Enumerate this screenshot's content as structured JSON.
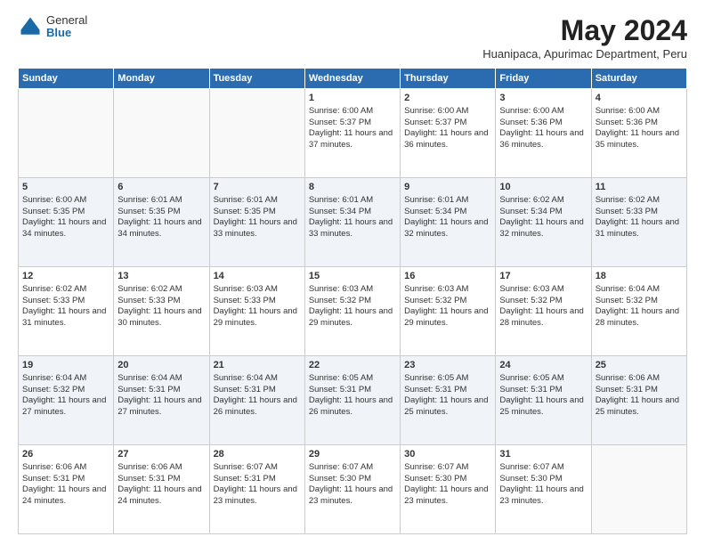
{
  "logo": {
    "general": "General",
    "blue": "Blue"
  },
  "title": "May 2024",
  "location": "Huanipaca, Apurimac Department, Peru",
  "days_of_week": [
    "Sunday",
    "Monday",
    "Tuesday",
    "Wednesday",
    "Thursday",
    "Friday",
    "Saturday"
  ],
  "weeks": [
    {
      "days": [
        {
          "num": "",
          "empty": true
        },
        {
          "num": "",
          "empty": true
        },
        {
          "num": "",
          "empty": true
        },
        {
          "num": "1",
          "sunrise": "6:00 AM",
          "sunset": "5:37 PM",
          "daylight": "11 hours and 37 minutes."
        },
        {
          "num": "2",
          "sunrise": "6:00 AM",
          "sunset": "5:37 PM",
          "daylight": "11 hours and 36 minutes."
        },
        {
          "num": "3",
          "sunrise": "6:00 AM",
          "sunset": "5:36 PM",
          "daylight": "11 hours and 36 minutes."
        },
        {
          "num": "4",
          "sunrise": "6:00 AM",
          "sunset": "5:36 PM",
          "daylight": "11 hours and 35 minutes."
        }
      ]
    },
    {
      "alt": true,
      "days": [
        {
          "num": "5",
          "sunrise": "6:00 AM",
          "sunset": "5:35 PM",
          "daylight": "11 hours and 34 minutes."
        },
        {
          "num": "6",
          "sunrise": "6:01 AM",
          "sunset": "5:35 PM",
          "daylight": "11 hours and 34 minutes."
        },
        {
          "num": "7",
          "sunrise": "6:01 AM",
          "sunset": "5:35 PM",
          "daylight": "11 hours and 33 minutes."
        },
        {
          "num": "8",
          "sunrise": "6:01 AM",
          "sunset": "5:34 PM",
          "daylight": "11 hours and 33 minutes."
        },
        {
          "num": "9",
          "sunrise": "6:01 AM",
          "sunset": "5:34 PM",
          "daylight": "11 hours and 32 minutes."
        },
        {
          "num": "10",
          "sunrise": "6:02 AM",
          "sunset": "5:34 PM",
          "daylight": "11 hours and 32 minutes."
        },
        {
          "num": "11",
          "sunrise": "6:02 AM",
          "sunset": "5:33 PM",
          "daylight": "11 hours and 31 minutes."
        }
      ]
    },
    {
      "days": [
        {
          "num": "12",
          "sunrise": "6:02 AM",
          "sunset": "5:33 PM",
          "daylight": "11 hours and 31 minutes."
        },
        {
          "num": "13",
          "sunrise": "6:02 AM",
          "sunset": "5:33 PM",
          "daylight": "11 hours and 30 minutes."
        },
        {
          "num": "14",
          "sunrise": "6:03 AM",
          "sunset": "5:33 PM",
          "daylight": "11 hours and 29 minutes."
        },
        {
          "num": "15",
          "sunrise": "6:03 AM",
          "sunset": "5:32 PM",
          "daylight": "11 hours and 29 minutes."
        },
        {
          "num": "16",
          "sunrise": "6:03 AM",
          "sunset": "5:32 PM",
          "daylight": "11 hours and 29 minutes."
        },
        {
          "num": "17",
          "sunrise": "6:03 AM",
          "sunset": "5:32 PM",
          "daylight": "11 hours and 28 minutes."
        },
        {
          "num": "18",
          "sunrise": "6:04 AM",
          "sunset": "5:32 PM",
          "daylight": "11 hours and 28 minutes."
        }
      ]
    },
    {
      "alt": true,
      "days": [
        {
          "num": "19",
          "sunrise": "6:04 AM",
          "sunset": "5:32 PM",
          "daylight": "11 hours and 27 minutes."
        },
        {
          "num": "20",
          "sunrise": "6:04 AM",
          "sunset": "5:31 PM",
          "daylight": "11 hours and 27 minutes."
        },
        {
          "num": "21",
          "sunrise": "6:04 AM",
          "sunset": "5:31 PM",
          "daylight": "11 hours and 26 minutes."
        },
        {
          "num": "22",
          "sunrise": "6:05 AM",
          "sunset": "5:31 PM",
          "daylight": "11 hours and 26 minutes."
        },
        {
          "num": "23",
          "sunrise": "6:05 AM",
          "sunset": "5:31 PM",
          "daylight": "11 hours and 25 minutes."
        },
        {
          "num": "24",
          "sunrise": "6:05 AM",
          "sunset": "5:31 PM",
          "daylight": "11 hours and 25 minutes."
        },
        {
          "num": "25",
          "sunrise": "6:06 AM",
          "sunset": "5:31 PM",
          "daylight": "11 hours and 25 minutes."
        }
      ]
    },
    {
      "days": [
        {
          "num": "26",
          "sunrise": "6:06 AM",
          "sunset": "5:31 PM",
          "daylight": "11 hours and 24 minutes."
        },
        {
          "num": "27",
          "sunrise": "6:06 AM",
          "sunset": "5:31 PM",
          "daylight": "11 hours and 24 minutes."
        },
        {
          "num": "28",
          "sunrise": "6:07 AM",
          "sunset": "5:31 PM",
          "daylight": "11 hours and 23 minutes."
        },
        {
          "num": "29",
          "sunrise": "6:07 AM",
          "sunset": "5:30 PM",
          "daylight": "11 hours and 23 minutes."
        },
        {
          "num": "30",
          "sunrise": "6:07 AM",
          "sunset": "5:30 PM",
          "daylight": "11 hours and 23 minutes."
        },
        {
          "num": "31",
          "sunrise": "6:07 AM",
          "sunset": "5:30 PM",
          "daylight": "11 hours and 23 minutes."
        },
        {
          "num": "",
          "empty": true
        }
      ]
    }
  ],
  "labels": {
    "sunrise": "Sunrise:",
    "sunset": "Sunset:",
    "daylight": "Daylight hours"
  }
}
